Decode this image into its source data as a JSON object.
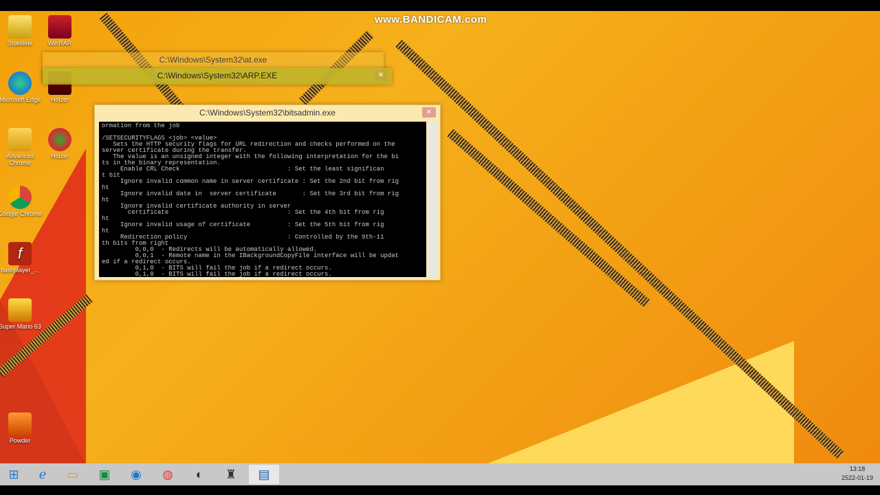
{
  "watermark": "www.BANDICAM.com",
  "desktop_icons": [
    {
      "label": "Stuksline"
    },
    {
      "label": "WinRAR"
    },
    {
      "label": "Microsoft Edge"
    },
    {
      "label": "Holzer"
    },
    {
      "label": "Advanced Chrome"
    },
    {
      "label": "Holzer"
    },
    {
      "label": "Google Chrome"
    },
    {
      "label": "flashplayer_..."
    },
    {
      "label": "Super Mario 63"
    },
    {
      "label": "Powder"
    }
  ],
  "windows": {
    "at": {
      "title": "C:\\Windows\\System32\\at.exe"
    },
    "arp": {
      "title": "C:\\Windows\\System32\\ARP.EXE"
    },
    "bitsadmin": {
      "title": "C:\\Windows\\System32\\bitsadmin.exe",
      "lines": [
        "ormation from the job",
        "",
        "/SETSECURITYFLAGS <job> <value>",
        "   Sets the HTTP security flags for URL redirection and checks performed on the",
        "server certificate during the transfer.",
        "   The value is an unsigned integer with the following interpretation for the bi",
        "ts in the binary representation.",
        "     Enable CRL Check                             : Set the least significan",
        "t bit",
        "     Ignore invalid common name in server certificate : Set the 2nd bit from rig",
        "ht",
        "     Ignore invalid date in  server certificate       : Set the 3rd bit from rig",
        "ht",
        "     Ignore invalid certificate authority in server",
        "       certificate                                : Set the 4th bit from rig",
        "ht",
        "     Ignore invalid usage of certificate          : Set the 5th bit from rig",
        "ht",
        "     Redirection policy                           : Controlled by the 9th-11",
        "th bits from right",
        "         0,0,0  - Redirects will be automatically allowed.",
        "         0,0,1  - Remote name in the IBackgroundCopyFile interface will be updat",
        "ed if a redirect occurs.",
        "         0,1,0  - BITS will fail the job if a redirect occurs.",
        "         0,1,0  - BITS will fail the job if a redirect occurs."
      ]
    }
  },
  "taskbar": {
    "buttons": [
      {
        "name": "start",
        "icon": "windows-logo-icon"
      },
      {
        "name": "ie",
        "icon": "internet-explorer-icon"
      },
      {
        "name": "explorer",
        "icon": "folder-icon"
      },
      {
        "name": "store",
        "icon": "store-icon"
      },
      {
        "name": "edge",
        "icon": "edge-icon"
      },
      {
        "name": "chrome",
        "icon": "chrome-icon"
      },
      {
        "name": "raccoon",
        "icon": "raccoon-icon"
      },
      {
        "name": "app",
        "icon": "figure-icon"
      },
      {
        "name": "console",
        "icon": "console-window-icon"
      }
    ],
    "time": "13:18",
    "date": "2522-01-19"
  }
}
